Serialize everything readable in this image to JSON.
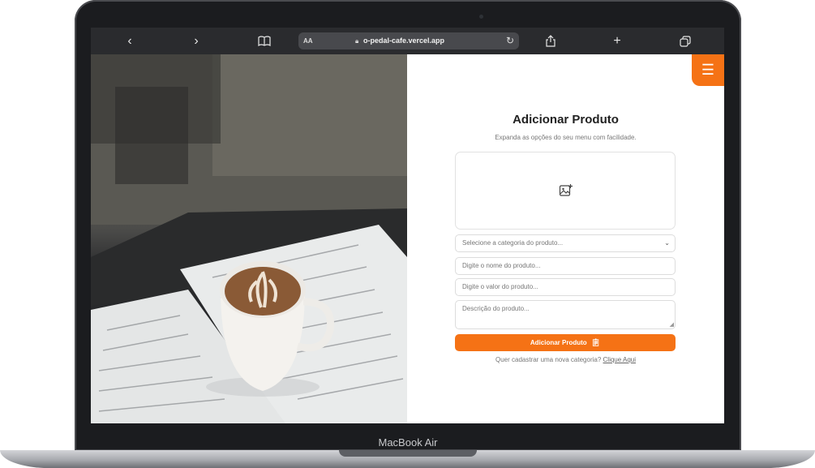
{
  "device": {
    "label": "MacBook Air"
  },
  "browser": {
    "url": "o-pedal-cafe.vercel.app",
    "text_size_label": "AA",
    "icons": [
      "back-icon",
      "forward-icon",
      "book-icon",
      "lock-icon",
      "reload-icon",
      "share-icon",
      "new-tab-icon",
      "tabs-icon"
    ]
  },
  "page": {
    "menu_icon": "hamburger-icon",
    "title": "Adicionar Produto",
    "subtitle": "Expanda as opções do seu menu com facilidade.",
    "upload_icon": "image-add-icon",
    "category_placeholder": "Selecione a categoria do produto...",
    "name_placeholder": "Digite o nome do produto...",
    "value_placeholder": "Digite o valor do produto...",
    "description_placeholder": "Descrição do produto...",
    "submit_label": "Adicionar Produto",
    "footer_text": "Quer cadastrar uma nova categoria?",
    "footer_link": "Clique Aqui"
  },
  "colors": {
    "accent": "#f57215",
    "frame": "#1b1c1f"
  }
}
